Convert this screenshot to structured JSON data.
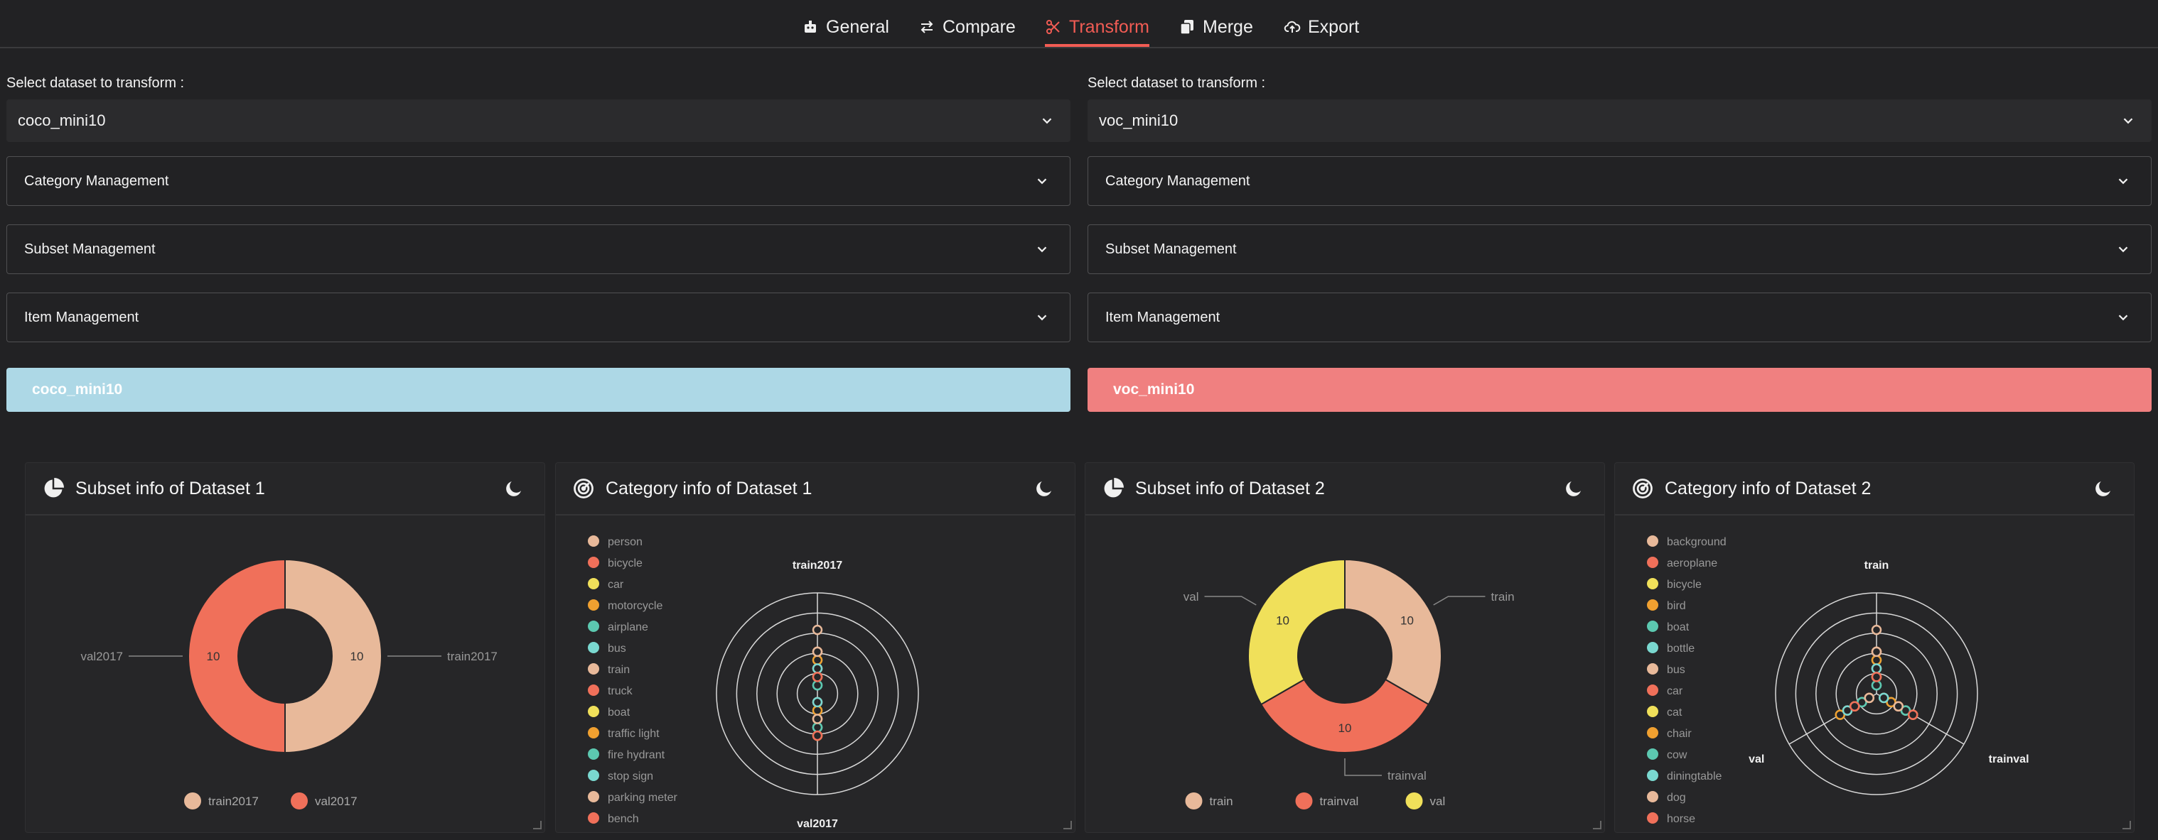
{
  "nav": {
    "tabs": [
      {
        "label": "General",
        "icon": "robot-icon",
        "active": false
      },
      {
        "label": "Compare",
        "icon": "swap-arrows-icon",
        "active": false
      },
      {
        "label": "Transform",
        "icon": "scissors-icon",
        "active": true
      },
      {
        "label": "Merge",
        "icon": "copy-icon",
        "active": false
      },
      {
        "label": "Export",
        "icon": "cloud-upload-icon",
        "active": false
      }
    ]
  },
  "colors": {
    "accent": "#f25c54",
    "banner1": "#add8e6",
    "banner2": "#f08080",
    "palette": [
      "#e8b99a",
      "#f0705a",
      "#f0e05a",
      "#f0a030",
      "#5cc8b0",
      "#7ad8d0"
    ]
  },
  "datasets": [
    {
      "select_label": "Select dataset to transform :",
      "selected": "coco_mini10",
      "accordions": [
        "Category Management",
        "Subset Management",
        "Item Management"
      ],
      "banner": "coco_mini10"
    },
    {
      "select_label": "Select dataset to transform :",
      "selected": "voc_mini10",
      "accordions": [
        "Category Management",
        "Subset Management",
        "Item Management"
      ],
      "banner": "voc_mini10"
    }
  ],
  "cards": [
    {
      "title": "Subset info of Dataset 1",
      "icon": "pie-chart-icon",
      "action_icon": "moon-icon"
    },
    {
      "title": "Category info of Dataset 1",
      "icon": "radar-icon",
      "action_icon": "moon-icon"
    },
    {
      "title": "Subset info of Dataset 2",
      "icon": "pie-chart-icon",
      "action_icon": "moon-icon"
    },
    {
      "title": "Category info of Dataset 2",
      "icon": "radar-icon",
      "action_icon": "moon-icon"
    }
  ],
  "chart_data": [
    {
      "type": "pie",
      "variant": "donut",
      "categories": [
        "train2017",
        "val2017"
      ],
      "values": [
        10,
        10
      ],
      "legend": [
        "train2017",
        "val2017"
      ],
      "legend_position": "bottom"
    },
    {
      "type": "radar",
      "indicators": [
        "train2017",
        "val2017"
      ],
      "legend": [
        "person",
        "bicycle",
        "car",
        "motorcycle",
        "airplane",
        "bus",
        "train",
        "truck",
        "boat",
        "traffic light",
        "fire hydrant",
        "stop sign",
        "parking meter",
        "bench"
      ],
      "legend_position": "left"
    },
    {
      "type": "pie",
      "variant": "donut",
      "categories": [
        "train",
        "trainval",
        "val"
      ],
      "values": [
        10,
        10,
        10
      ],
      "legend": [
        "train",
        "trainval",
        "val"
      ],
      "legend_position": "bottom"
    },
    {
      "type": "radar",
      "indicators": [
        "train",
        "trainval",
        "val"
      ],
      "legend": [
        "background",
        "aeroplane",
        "bicycle",
        "bird",
        "boat",
        "bottle",
        "bus",
        "car",
        "cat",
        "chair",
        "cow",
        "diningtable",
        "dog",
        "horse"
      ],
      "legend_position": "left"
    }
  ]
}
